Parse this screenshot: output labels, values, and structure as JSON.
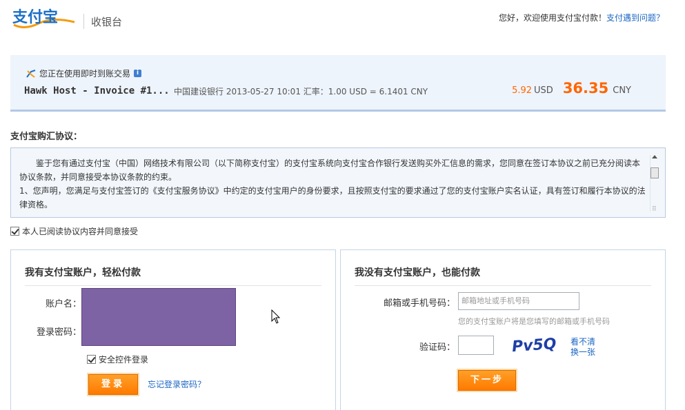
{
  "header": {
    "logo_text": "支付宝",
    "cashier_label": "收银台",
    "welcome_text": "您好，欢迎使用支付宝付款！",
    "help_link": "支付遇到问题？"
  },
  "trade": {
    "type_text": "您正在使用即时到账交易",
    "title": "Hawk Host - Invoice #1...",
    "meta": "中国建设银行 2013-05-27 10:01 汇率：1.00 USD = 6.1401 CNY",
    "usd_amount": "5.92",
    "usd_unit": "USD",
    "cny_amount": "36.35",
    "cny_unit": "CNY"
  },
  "agreement": {
    "title": "支付宝购汇协议：",
    "paragraph1": "鉴于您有通过支付宝（中国）网络技术有限公司（以下简称支付宝）的支付宝系统向支付宝合作银行发送购买外汇信息的需求，您同意在签订本协议之前已充分阅读本协议条款，并同意接受本协议条款的约束。",
    "paragraph2": "1、您声明，您满足与支付宝签订的《支付宝服务协议》中约定的支付宝用户的身份要求，且按照支付宝的要求通过了您的支付宝账户实名认证，具有签订和履行本协议的法律资格。",
    "accept_label": "本人已阅读协议内容并同意接受"
  },
  "login_panel": {
    "title": "我有支付宝账户，轻松付款",
    "account_label": "账户名：",
    "password_label": "登录密码：",
    "security_label": "安全控件登录",
    "login_button": "登录",
    "forgot_link": "忘记登录密码？"
  },
  "guest_panel": {
    "title": "我没有支付宝账户，也能付款",
    "email_label": "邮箱或手机号码：",
    "email_placeholder": "邮箱地址或手机号码",
    "email_hint": "您的支付宝账户将是您填写的邮箱或手机号码",
    "captcha_label": "验证码：",
    "captcha_text": "Pv5Q",
    "refresh_line1": "看不清",
    "refresh_line2": "换一张",
    "next_button": "下一步"
  },
  "colors": {
    "accent_orange": "#ff6600",
    "link_blue": "#1a66c4",
    "panel_bg": "#eef4fc",
    "mask_purple": "#7e63a4"
  }
}
